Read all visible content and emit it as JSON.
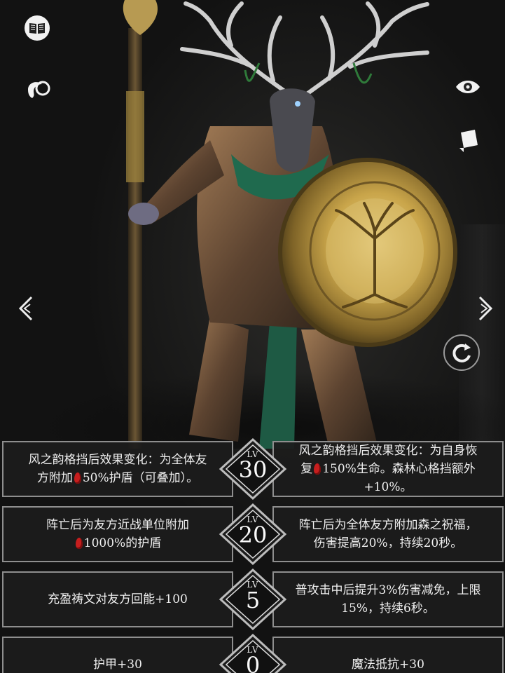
{
  "scene": {
    "character": "stag-headed-guardian",
    "accent_colors": {
      "gold": "#c9a54a",
      "green": "#1f6a4e",
      "badge_border": "#bcbcbc"
    }
  },
  "side_icons": {
    "left": [
      "book-icon",
      "chat-bubble-icon",
      "prev-arrow-icon"
    ],
    "right": [
      "eye-icon",
      "card-icon",
      "next-arrow-icon",
      "rotate-icon"
    ]
  },
  "skills": [
    {
      "level_tag": "LV",
      "level": "30",
      "left_lines": [
        "风之韵格挡后效果变化：为全体友",
        "方附加[B]50%护盾（可叠加）。"
      ],
      "right_lines": [
        "风之韵格挡后效果变化：为自身恢",
        "复[B]150%生命。森林心格挡额外",
        "+10%。"
      ]
    },
    {
      "level_tag": "LV",
      "level": "20",
      "left_lines": [
        "阵亡后为友方近战单位附加",
        "[B]1000%的护盾"
      ],
      "right_lines": [
        "阵亡后为全体友方附加森之祝福，",
        "伤害提高20%，持续20秒。"
      ]
    },
    {
      "level_tag": "LV",
      "level": "5",
      "left_lines": [
        "充盈祷文对友方回能+100"
      ],
      "right_lines": [
        "普攻击中后提升3%伤害减免，上限",
        "15%，持续6秒。"
      ]
    },
    {
      "level_tag": "LV",
      "level": "0",
      "left_lines": [
        "护甲+30"
      ],
      "right_lines": [
        "魔法抵抗+30"
      ]
    }
  ]
}
